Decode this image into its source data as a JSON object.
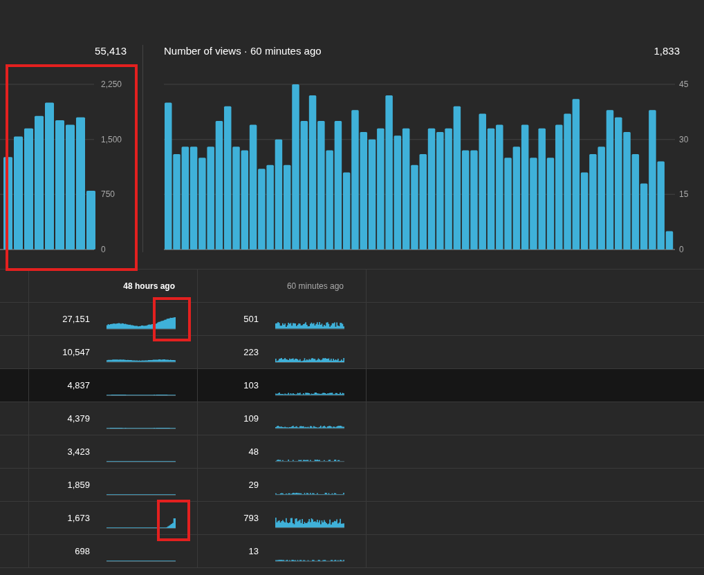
{
  "charts": [
    {
      "total": "55,413",
      "chart_data": {
        "type": "bar",
        "values": [
          1260,
          1540,
          1650,
          1820,
          2000,
          1760,
          1700,
          1800,
          800
        ],
        "ylim": [
          0,
          2250
        ],
        "yticks": [
          {
            "value": 0,
            "label": "0"
          },
          {
            "value": 750,
            "label": "750"
          },
          {
            "value": 1500,
            "label": "1,500"
          },
          {
            "value": 2250,
            "label": "2,250"
          }
        ]
      }
    },
    {
      "total": "1,833",
      "chart_data": {
        "type": "bar",
        "title": "Number of views · 60 minutes ago",
        "values": [
          40,
          26,
          28,
          28,
          25,
          28,
          35,
          39,
          28,
          27,
          34,
          22,
          23,
          30,
          23,
          45,
          35,
          42,
          35,
          27,
          35,
          21,
          38,
          32,
          30,
          33,
          42,
          31,
          33,
          23,
          26,
          33,
          32,
          33,
          39,
          27,
          27,
          37,
          33,
          34,
          25,
          28,
          34,
          25,
          33,
          25,
          34,
          37,
          41,
          21,
          26,
          28,
          38,
          36,
          32,
          26,
          18,
          38,
          24,
          5
        ],
        "ylim": [
          0,
          45
        ],
        "yticks": [
          0,
          15,
          30,
          45
        ]
      }
    }
  ],
  "table": {
    "columns": [
      {
        "label": "48 hours ago",
        "selected": true
      },
      {
        "label": "60 minutes ago",
        "selected": false
      }
    ],
    "rows": [
      {
        "views_48h": "27,151",
        "views_60m": "501",
        "hovered": false
      },
      {
        "views_48h": "10,547",
        "views_60m": "223",
        "hovered": false
      },
      {
        "views_48h": "4,837",
        "views_60m": "103",
        "hovered": true
      },
      {
        "views_48h": "4,379",
        "views_60m": "109",
        "hovered": false
      },
      {
        "views_48h": "3,423",
        "views_60m": "48",
        "hovered": false
      },
      {
        "views_48h": "1,859",
        "views_60m": "29",
        "hovered": false
      },
      {
        "views_48h": "1,673",
        "views_60m": "793",
        "hovered": false
      },
      {
        "views_48h": "698",
        "views_60m": "13",
        "hovered": false
      }
    ]
  }
}
